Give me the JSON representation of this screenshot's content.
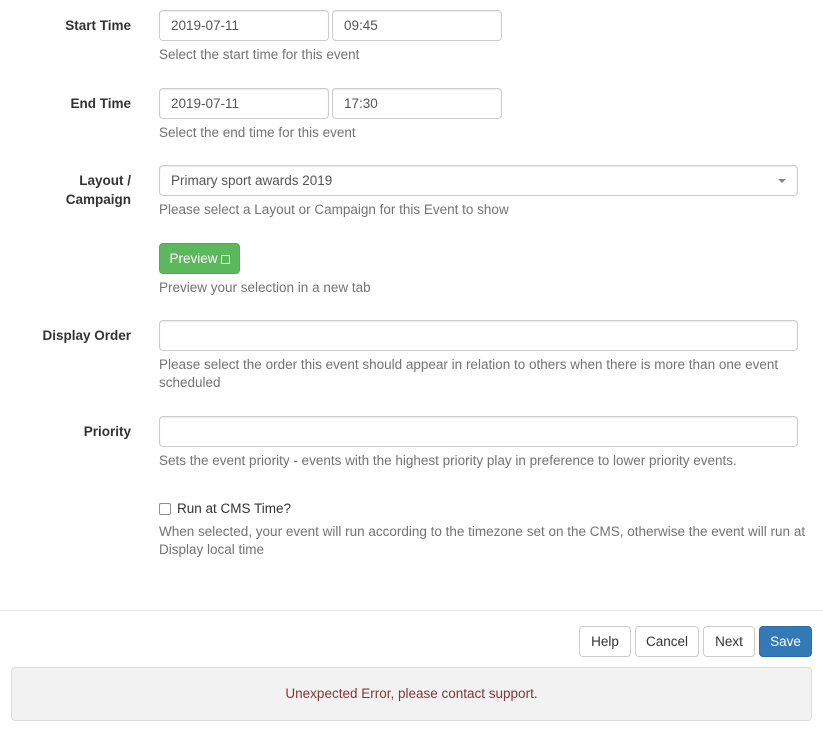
{
  "form": {
    "start_time": {
      "label": "Start Time",
      "date": "2019-07-11",
      "time": "09:45",
      "help": "Select the start time for this event"
    },
    "end_time": {
      "label": "End Time",
      "date": "2019-07-11",
      "time": "17:30",
      "help": "Select the end time for this event"
    },
    "layout": {
      "label_line1": "Layout /",
      "label_line2": "Campaign",
      "selected": "Primary sport awards 2019",
      "help": "Please select a Layout or Campaign for this Event to show"
    },
    "preview": {
      "label": "Preview",
      "help": "Preview your selection in a new tab"
    },
    "display_order": {
      "label": "Display Order",
      "value": "",
      "help_line1": "Please select the order this event should appear in relation to others when there is more than one event",
      "help_line2": "scheduled"
    },
    "priority": {
      "label": "Priority",
      "value": "",
      "help": "Sets the event priority - events with the highest priority play in preference to lower priority events."
    },
    "run_at_cms": {
      "label": "Run at CMS Time?",
      "checked": false,
      "help_line1": "When selected, your event will run according to the timezone set on the CMS, otherwise the event will run at",
      "help_line2": "Display local time"
    }
  },
  "footer": {
    "help": "Help",
    "cancel": "Cancel",
    "next": "Next",
    "save": "Save"
  },
  "alert": {
    "message": "Unexpected Error, please contact support."
  },
  "colors": {
    "preview_button": "#5cb85c",
    "save_button": "#337ab7",
    "error_text": "#843534"
  }
}
